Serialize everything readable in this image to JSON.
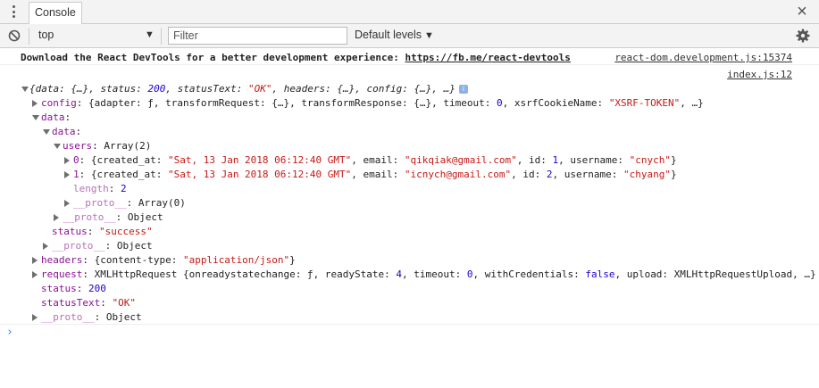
{
  "tabbar": {
    "tab_label": "Console",
    "close_glyph": "×"
  },
  "toolbar": {
    "context": "top",
    "filter_placeholder": "Filter",
    "levels": "Default levels",
    "levels_arrow": "▼",
    "context_arrow": "▼"
  },
  "icons": [
    "kebab-menu-icon",
    "clear-console-icon",
    "settings-gear-icon",
    "close-icon",
    "info-icon",
    "prompt-chevron-icon"
  ],
  "colors": {
    "key": "#881391",
    "key_dim": "#b871b8",
    "string": "#c41a16",
    "number": "#1c00cf",
    "prompt": "#367cf1"
  },
  "banner": {
    "text": "Download the React DevTools for a better development experience: ",
    "link": "https://fb.me/react-devtools",
    "source": "react-dom.development.js:15374"
  },
  "log": {
    "source": "index.js:12",
    "summary": "{data: {…}, status: 200, statusText: \"OK\", headers: {…}, config: {…}, …}",
    "config_key": "config",
    "config_val": "{adapter: ƒ, transformRequest: {…}, transformResponse: {…}, timeout: 0, xsrfCookieName: \"XSRF-TOKEN\", …}",
    "data_key": "data",
    "data_inner_key": "data",
    "users_key": "users",
    "users_val": "Array(2)",
    "user0_key": "0",
    "user0_val": "{created_at: \"Sat, 13 Jan 2018 06:12:40 GMT\", email: \"qikqiak@gmail.com\", id: 1, username: \"cnych\"}",
    "user1_key": "1",
    "user1_val": "{created_at: \"Sat, 13 Jan 2018 06:12:40 GMT\", email: \"icnych@gmail.com\", id: 2, username: \"chyang\"}",
    "length_key": "length",
    "length_val": "2",
    "proto_key": "__proto__",
    "proto_array": "Array(0)",
    "proto_object": "Object",
    "status_key": "status",
    "status_inner_val": "\"success\"",
    "headers_key": "headers",
    "headers_val": "{content-type: \"application/json\"}",
    "request_key": "request",
    "request_val": "XMLHttpRequest {onreadystatechange: ƒ, readyState: 4, timeout: 0, withCredentials: false, upload: XMLHttpRequestUpload, …}",
    "status_val": "200",
    "statustext_key": "statusText",
    "statustext_val": "\"OK\""
  },
  "prompt_glyph": "›"
}
